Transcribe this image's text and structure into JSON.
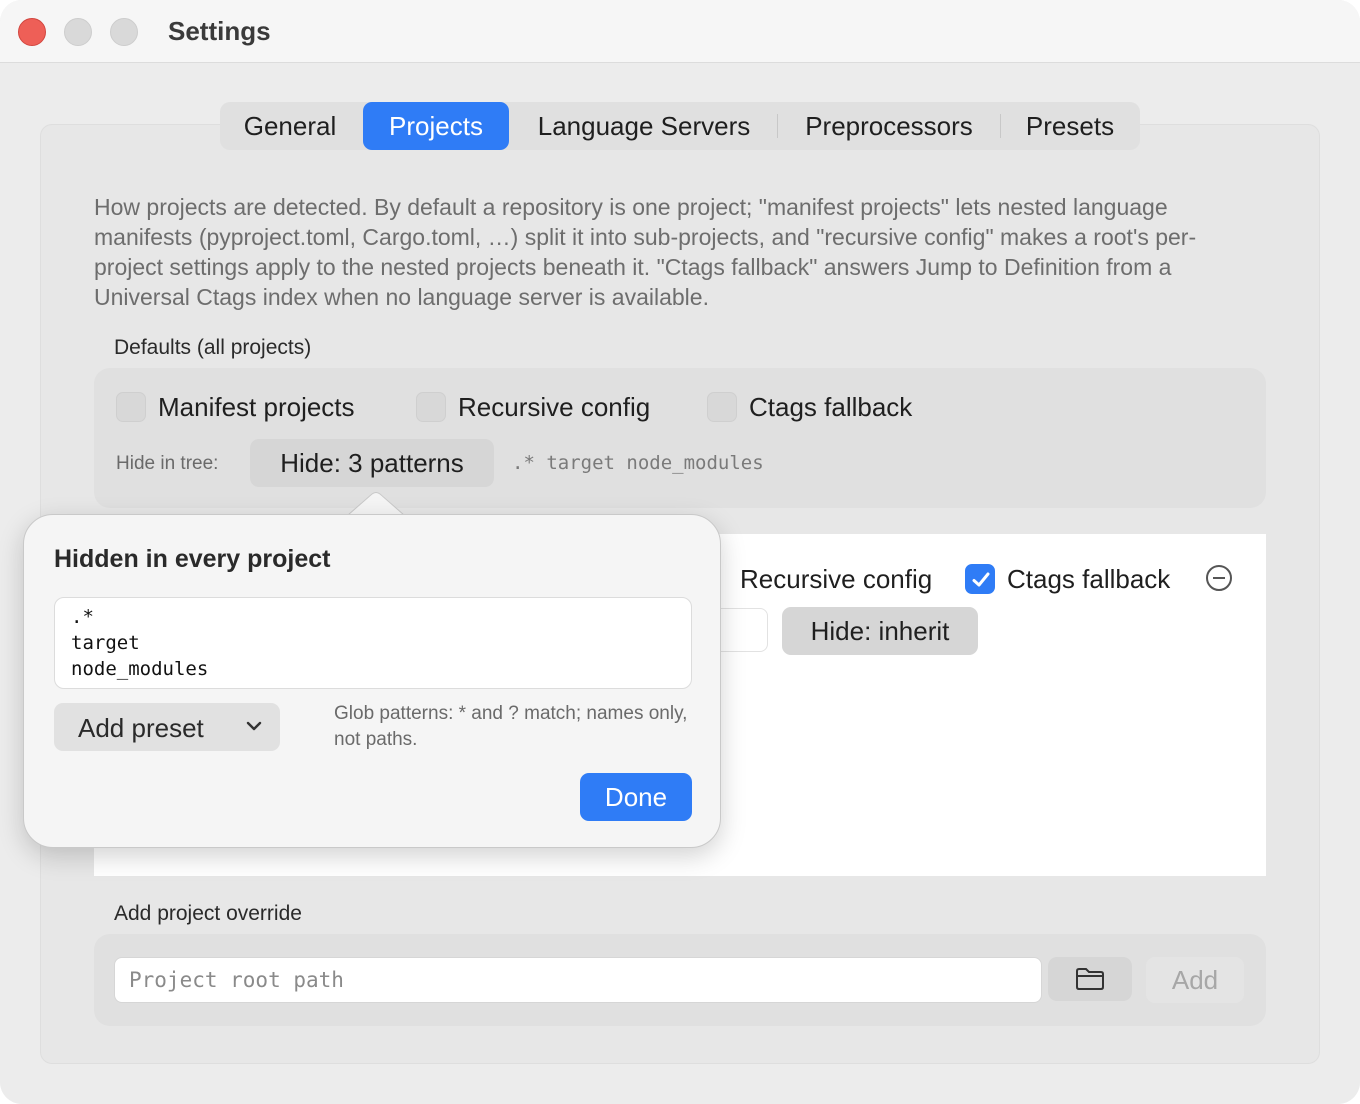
{
  "window": {
    "title": "Settings"
  },
  "tabs": [
    {
      "label": "General",
      "active": false
    },
    {
      "label": "Projects",
      "active": true
    },
    {
      "label": "Language Servers",
      "active": false
    },
    {
      "label": "Preprocessors",
      "active": false
    },
    {
      "label": "Presets",
      "active": false
    }
  ],
  "description": "How projects are detected. By default a repository is one project; \"manifest projects\" lets nested language manifests (pyproject.toml, Cargo.toml, …) split it into sub-projects, and \"recursive config\" makes a root's per-project settings apply to the nested projects beneath it. \"Ctags fallback\" answers Jump to Definition from a Universal Ctags index when no language server is available.",
  "defaults": {
    "label": "Defaults (all projects)",
    "manifest_label": "Manifest projects",
    "manifest_checked": false,
    "recursive_label": "Recursive config",
    "recursive_checked": false,
    "ctags_label": "Ctags fallback",
    "ctags_checked": false,
    "hide_label": "Hide in tree:",
    "hide_button": "Hide: 3 patterns",
    "hide_patterns_inline": ".* target node_modules"
  },
  "override_row": {
    "recursive_label": "Recursive config",
    "recursive_checked": false,
    "ctags_label": "Ctags fallback",
    "ctags_checked": true,
    "hide_button": "Hide: inherit"
  },
  "add_override": {
    "label": "Add project override",
    "placeholder": "Project root path",
    "add_label": "Add",
    "folder_icon": "folder-icon"
  },
  "popover": {
    "title": "Hidden in every project",
    "patterns": [
      ".*",
      "target",
      "node_modules"
    ],
    "preset_label": "Add preset",
    "hint": "Glob patterns: * and ? match; names only, not paths.",
    "done_label": "Done"
  },
  "colors": {
    "accent": "#2f7cf6",
    "close": "#ee5f57"
  }
}
